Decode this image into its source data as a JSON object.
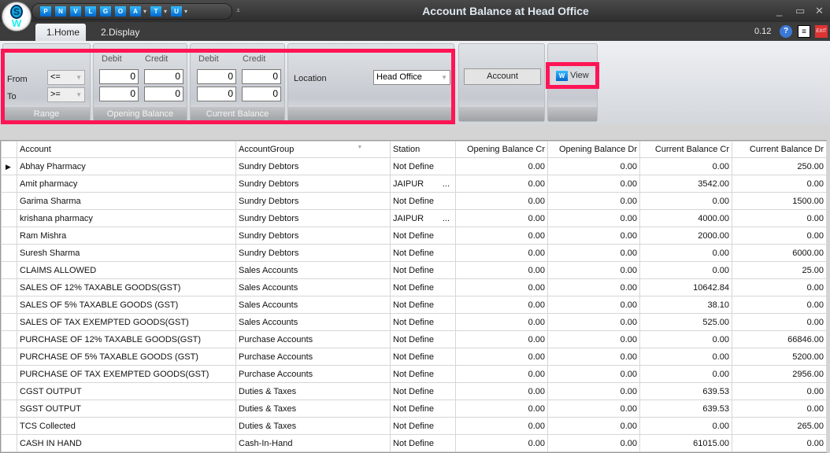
{
  "window": {
    "title": "Account Balance  at Head Office",
    "minimize": "_",
    "maximize": "▭",
    "close": "✕"
  },
  "quick_access": [
    {
      "label": "P"
    },
    {
      "label": "N"
    },
    {
      "label": "V"
    },
    {
      "label": "L"
    },
    {
      "label": "G"
    },
    {
      "label": "O"
    },
    {
      "label": "A",
      "dropdown": true
    },
    {
      "label": "T",
      "dropdown": true
    },
    {
      "label": "U",
      "dropdown": true
    }
  ],
  "tabs": [
    {
      "label": "1.Home",
      "active": true
    },
    {
      "label": "2.Display"
    }
  ],
  "version": "0.12",
  "ribbon": {
    "range": {
      "caption": "Range",
      "from_label": "From",
      "to_label": "To",
      "from_value": "<=",
      "to_value": ">="
    },
    "opening_balance": {
      "caption": "Opening Balance",
      "debit_label": "Debit",
      "credit_label": "Credit",
      "from_debit": "0",
      "from_credit": "0",
      "to_debit": "0",
      "to_credit": "0"
    },
    "current_balance": {
      "caption": "Current Balance",
      "debit_label": "Debit",
      "credit_label": "Credit",
      "from_debit": "0",
      "from_credit": "0",
      "to_debit": "0",
      "to_credit": "0"
    },
    "location": {
      "label": "Location",
      "value": "Head Office"
    },
    "account_button": "Account",
    "view_button": "View",
    "highlight_color": "#ff1455"
  },
  "grid": {
    "columns": [
      "Account",
      "AccountGroup",
      "Station",
      "Opening Balance Cr",
      "Opening Balance Dr",
      "Current Balance Cr",
      "Current Balance Dr"
    ],
    "rows": [
      [
        "Abhay Pharmacy",
        "Sundry Debtors",
        "Not Define",
        "0.00",
        "0.00",
        "0.00",
        "250.00"
      ],
      [
        "Amit pharmacy",
        "Sundry Debtors",
        "JAIPUR",
        "0.00",
        "0.00",
        "3542.00",
        "0.00"
      ],
      [
        "Garima Sharma",
        "Sundry Debtors",
        "Not Define",
        "0.00",
        "0.00",
        "0.00",
        "1500.00"
      ],
      [
        "krishana pharmacy",
        "Sundry Debtors",
        "JAIPUR",
        "0.00",
        "0.00",
        "4000.00",
        "0.00"
      ],
      [
        "Ram Mishra",
        "Sundry Debtors",
        "Not Define",
        "0.00",
        "0.00",
        "2000.00",
        "0.00"
      ],
      [
        "Suresh Sharma",
        "Sundry Debtors",
        "Not Define",
        "0.00",
        "0.00",
        "0.00",
        "6000.00"
      ],
      [
        "CLAIMS ALLOWED",
        "Sales Accounts",
        "Not Define",
        "0.00",
        "0.00",
        "0.00",
        "25.00"
      ],
      [
        "SALES OF 12% TAXABLE GOODS(GST)",
        "Sales Accounts",
        "Not Define",
        "0.00",
        "0.00",
        "10642.84",
        "0.00"
      ],
      [
        "SALES OF 5% TAXABLE GOODS (GST)",
        "Sales Accounts",
        "Not Define",
        "0.00",
        "0.00",
        "38.10",
        "0.00"
      ],
      [
        "SALES OF TAX EXEMPTED GOODS(GST)",
        "Sales Accounts",
        "Not Define",
        "0.00",
        "0.00",
        "525.00",
        "0.00"
      ],
      [
        "PURCHASE OF 12% TAXABLE GOODS(GST)",
        "Purchase Accounts",
        "Not Define",
        "0.00",
        "0.00",
        "0.00",
        "66846.00"
      ],
      [
        "PURCHASE OF 5% TAXABLE GOODS (GST)",
        "Purchase Accounts",
        "Not Define",
        "0.00",
        "0.00",
        "0.00",
        "5200.00"
      ],
      [
        "PURCHASE OF TAX EXEMPTED GOODS(GST)",
        "Purchase Accounts",
        "Not Define",
        "0.00",
        "0.00",
        "0.00",
        "2956.00"
      ],
      [
        "CGST OUTPUT",
        "Duties & Taxes",
        "Not Define",
        "0.00",
        "0.00",
        "639.53",
        "0.00"
      ],
      [
        "SGST OUTPUT",
        "Duties & Taxes",
        "Not Define",
        "0.00",
        "0.00",
        "639.53",
        "0.00"
      ],
      [
        "TCS Collected",
        "Duties & Taxes",
        "Not Define",
        "0.00",
        "0.00",
        "0.00",
        "265.00"
      ],
      [
        "CASH IN HAND",
        "Cash-In-Hand",
        "Not Define",
        "0.00",
        "0.00",
        "61015.00",
        "0.00"
      ]
    ],
    "station_ellipsis": "..."
  }
}
